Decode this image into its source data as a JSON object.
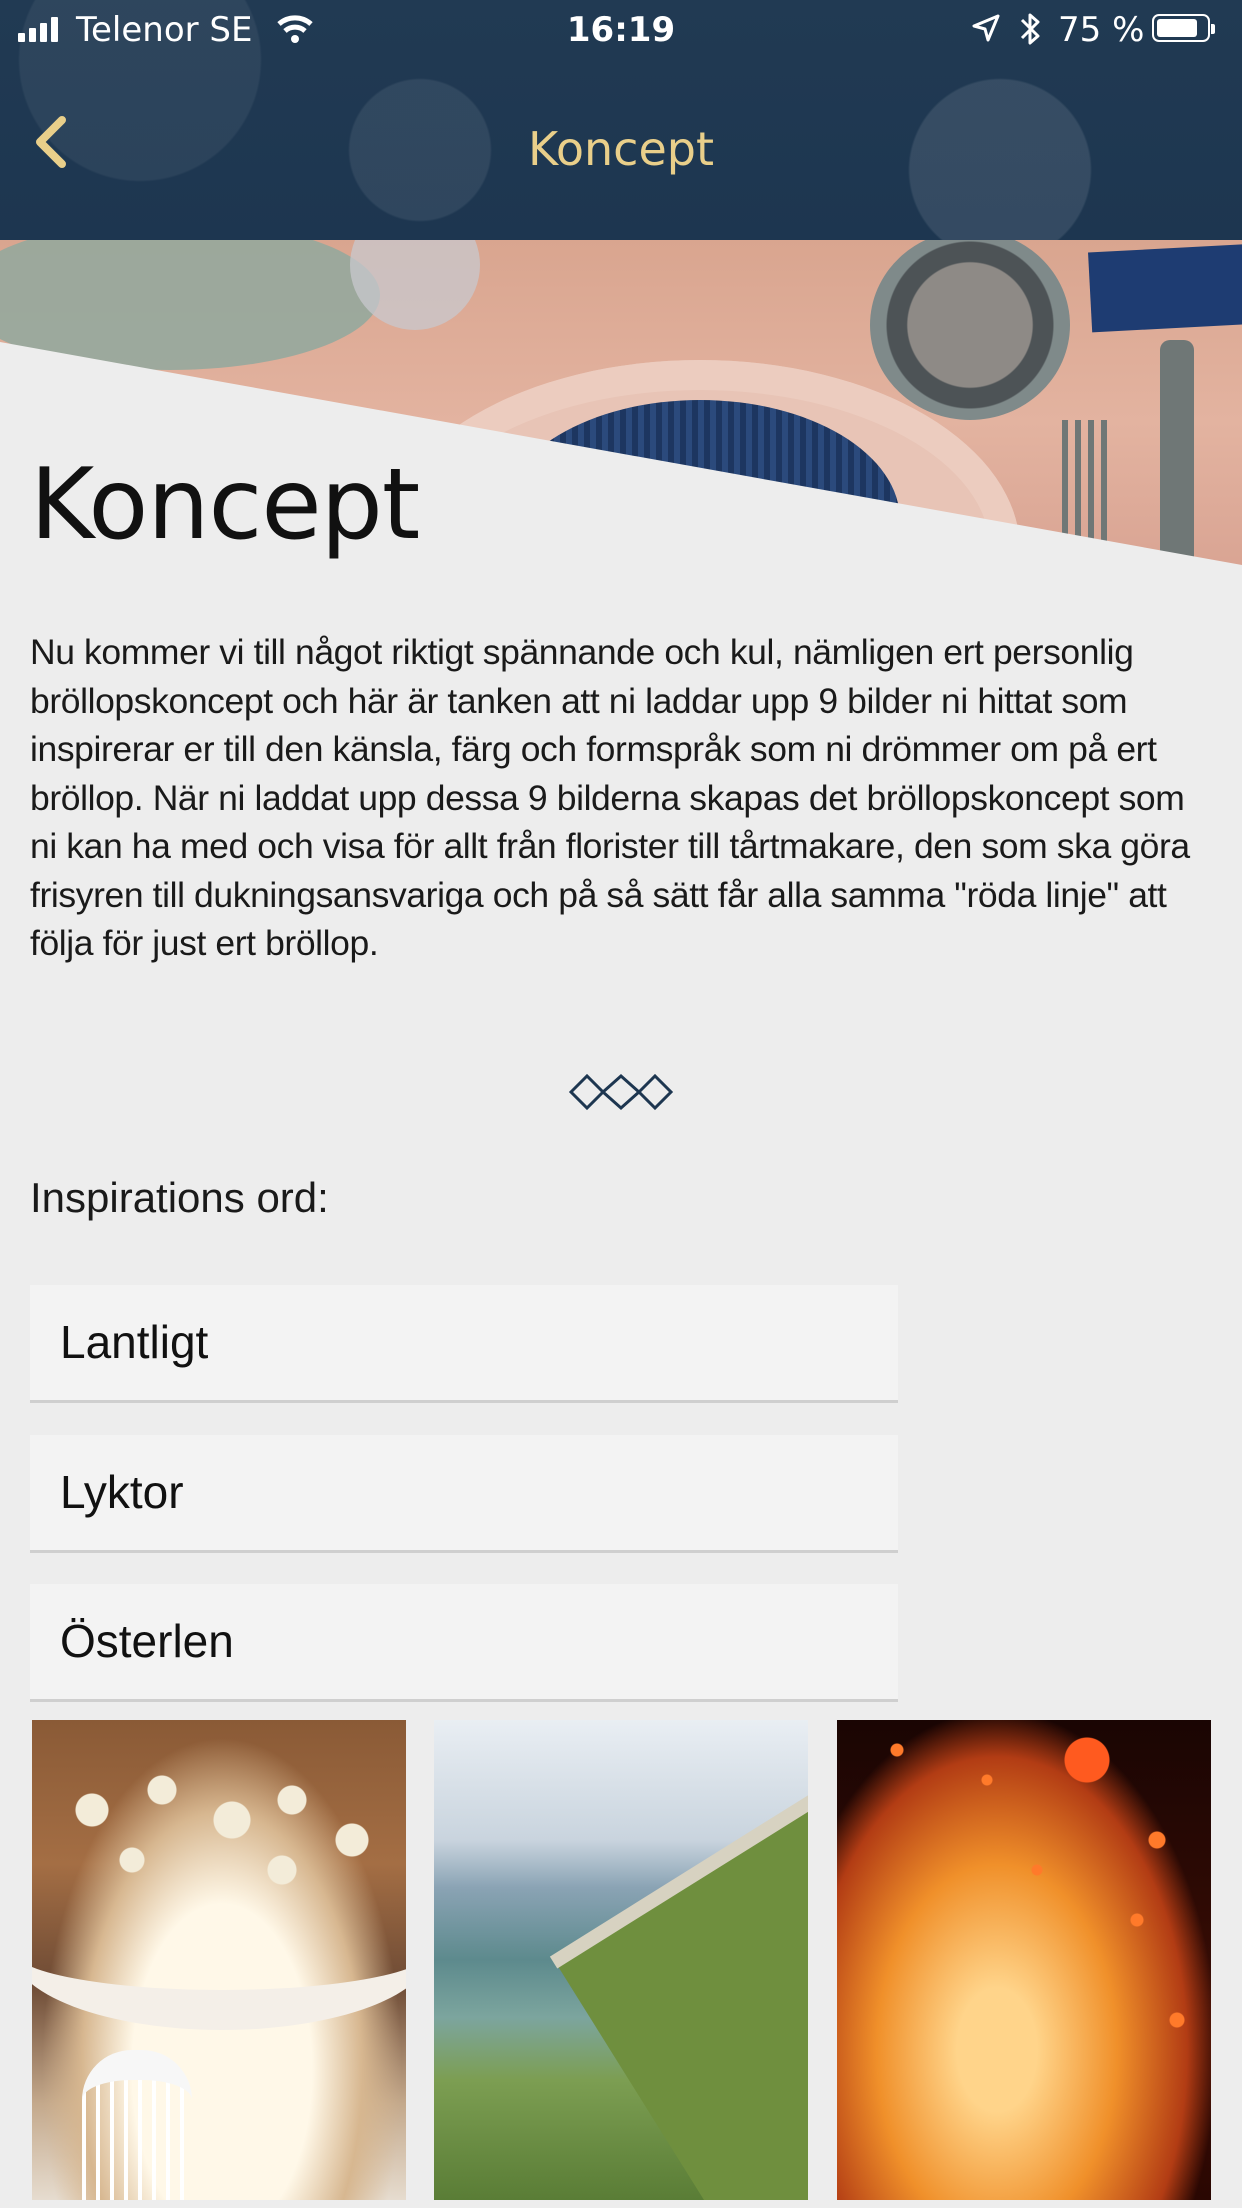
{
  "status_bar": {
    "carrier": "Telenor SE",
    "time": "16:19",
    "battery": "75 %"
  },
  "nav": {
    "title": "Koncept"
  },
  "page": {
    "title": "Koncept",
    "intro": "Nu kommer vi till något riktigt spännande och kul, nämligen ert personlig bröllopskoncept och här är tanken att ni laddar upp 9 bilder ni hittat som inspirerar er till den känsla, färg och formspråk som ni drömmer om på ert bröllop. När ni laddat upp dessa 9 bilderna skapas det bröllopskoncept som ni kan ha med och visa för allt från florister till tårtmakare, den som ska göra frisyren till dukningsansvariga och på så sätt får alla samma \"röda linje\" att följa för just ert bröllop."
  },
  "inspiration": {
    "label": "Inspirations ord:",
    "words": [
      "Lantligt",
      "Lyktor",
      "Österlen"
    ]
  },
  "colors": {
    "header": "#1d3650",
    "nav_accent": "#e9cf8a",
    "background": "#ededed",
    "field": "#f3f3f3"
  },
  "icons": {
    "back": "chevron-left-icon",
    "ornament": "diamond-ornament-icon"
  }
}
